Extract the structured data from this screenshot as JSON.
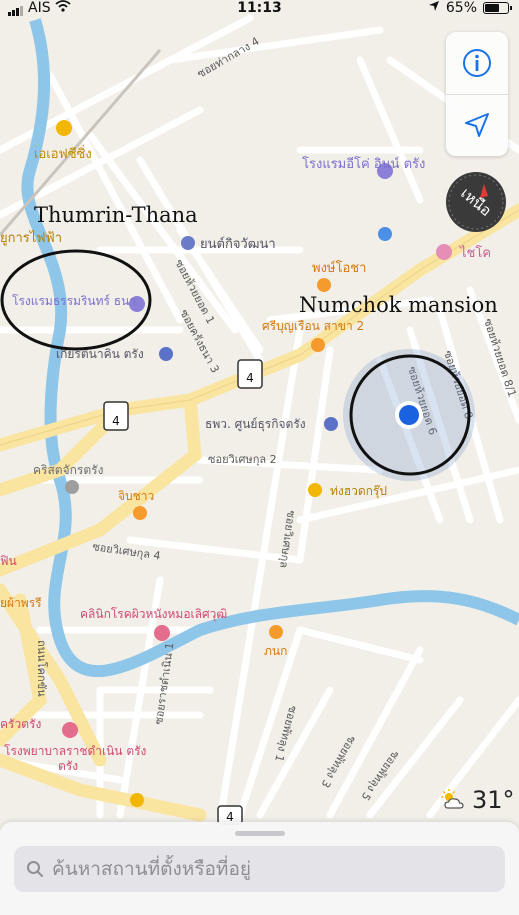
{
  "status_bar": {
    "carrier": "AIS",
    "time": "11:13",
    "battery": "65%",
    "battery_level": 0.65
  },
  "map": {
    "streets": [
      "ซอยท่ากลาง 4",
      "ซอยห้วยยอด 1",
      "ซอยครังธนา 3",
      "ซอยวิเศษกุล 2",
      "ซอยวิเศษกุล 4",
      "ซอยวิเศษกุล",
      "ถนนโคกขัน",
      "ซอยพัทลุง 1",
      "ซอยพัทลุง 3",
      "ซอยพัทลุง 5",
      "ซอยห้วยยอด 6",
      "ซอยห้วยยอด 8/1",
      "ซอยห้วยยอด 8",
      "ซอยราชดำเนิน 1"
    ],
    "pois": {
      "ae_ar": "เอเอฟซีซิ่ง",
      "hotel_eco": "โรงแรมอีโค่ อินน์ ตรัง",
      "hotel_thumrin": "โรงแรมธรรมรินทร์ ธนา",
      "yontkit": "ยนต์กิจวัฒนา",
      "electric": "ยูการไฟฟ้า",
      "phongpochaa": "พงษ์โอชา",
      "chaiko": "ไชโค",
      "sribunruen": "ศรีบุญเรือน สาขา 2",
      "trang_station": "เกียรตินาคิน ตรัง",
      "bank": "ธพว. ศูนย์ธุรกิจตรัง",
      "church": "คริสตจักรตรัง",
      "jibchao": "จิบชาว",
      "thongsuay": "ท่งฮวดกรุ๊ป",
      "clinic": "คลินิกโรคผิวหนังหมอเลิศวุฒิ",
      "panok": "ภนก",
      "hospital": "โรงพยาบาลราชดำเนิน ตรัง",
      "khrua": "ครัวตรัง",
      "khem": "ยผ้าพรรี",
      "phin": "ฟิน",
      "trang_left": "ตรัง"
    },
    "route_shields": [
      "4",
      "4",
      "4"
    ],
    "annotations": {
      "thumrin": "Thumrin-Thana",
      "numchok": "Numchok mansion"
    }
  },
  "controls": {
    "info_icon": "info-icon",
    "locate_icon": "location-arrow-icon",
    "compass_label": "เหนือ"
  },
  "weather": {
    "icon": "partly-sunny-icon",
    "temperature": "31°"
  },
  "search": {
    "placeholder": "ค้นหาสถานที่ตั้งหรือที่อยู่"
  },
  "colors": {
    "water": "#8dc6e8",
    "major_road": "#f9e4a0",
    "user_dot": "#1a62e0"
  }
}
